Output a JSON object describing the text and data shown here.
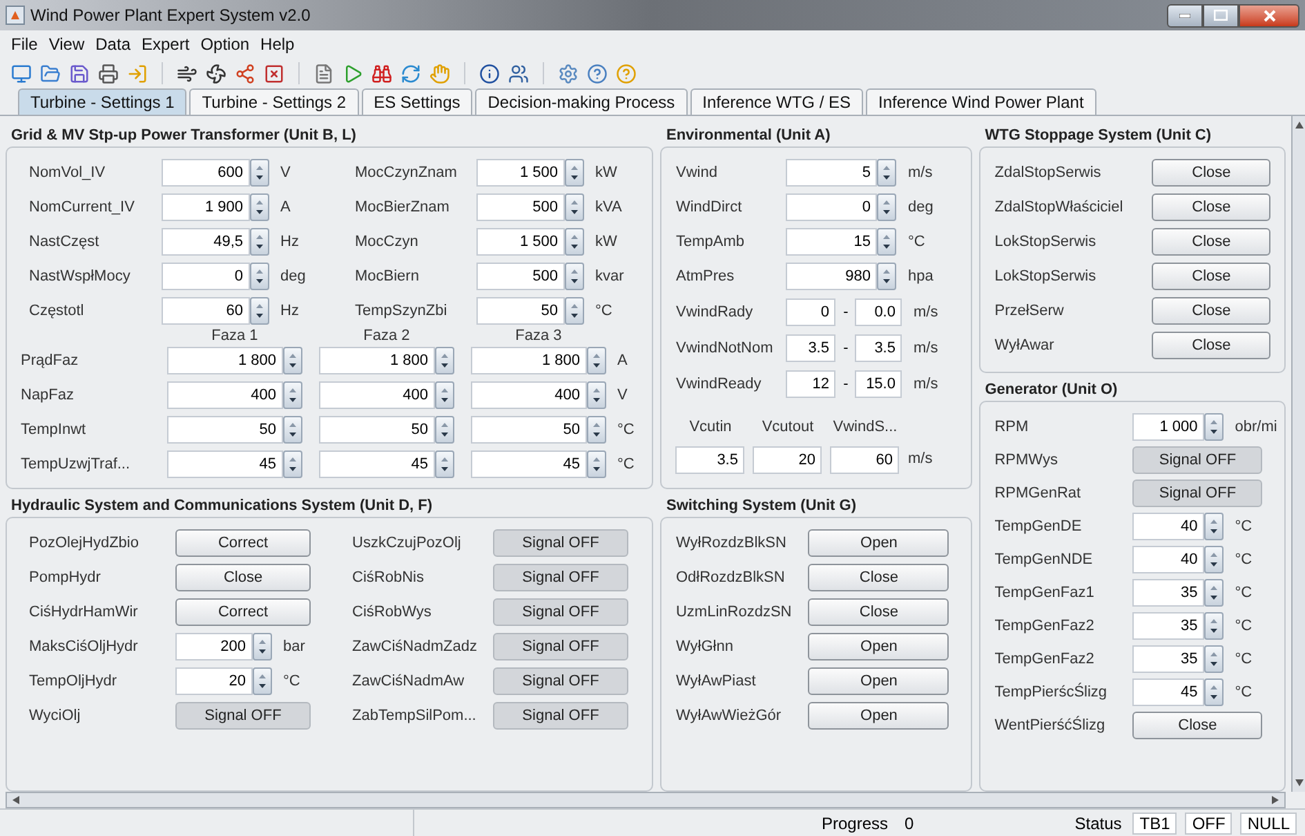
{
  "window": {
    "title": "Wind Power Plant Expert System  v2.0"
  },
  "menu": [
    "File",
    "View",
    "Data",
    "Expert",
    "Option",
    "Help"
  ],
  "tabs": [
    {
      "label": "Turbine - Settings 1",
      "selected": true
    },
    {
      "label": "Turbine - Settings 2",
      "selected": false
    },
    {
      "label": "ES Settings",
      "selected": false
    },
    {
      "label": "Decision-making Process",
      "selected": false
    },
    {
      "label": "Inference WTG / ES",
      "selected": false
    },
    {
      "label": "Inference Wind Power Plant",
      "selected": false
    }
  ],
  "grid_transformer": {
    "title": "Grid & MV Stp-up Power Transformer (Unit B, L)",
    "left_fields": [
      {
        "label": "NomVol_IV",
        "value": "600",
        "unit": "V"
      },
      {
        "label": "NomCurrent_IV",
        "value": "1 900",
        "unit": "A"
      },
      {
        "label": "NastCzęst",
        "value": "49,5",
        "unit": "Hz"
      },
      {
        "label": "NastWspłMocy",
        "value": "0",
        "unit": "deg"
      },
      {
        "label": "Częstotl",
        "value": "60",
        "unit": "Hz"
      }
    ],
    "right_fields": [
      {
        "label": "MocCzynZnam",
        "value": "1 500",
        "unit": "kW"
      },
      {
        "label": "MocBierZnam",
        "value": "500",
        "unit": "kVA"
      },
      {
        "label": "MocCzyn",
        "value": "1 500",
        "unit": "kW"
      },
      {
        "label": "MocBiern",
        "value": "500",
        "unit": "kvar"
      },
      {
        "label": "TempSzynZbi",
        "value": "50",
        "unit": "°C"
      }
    ],
    "phase_headers": [
      "Faza 1",
      "Faza 2",
      "Faza 3"
    ],
    "phase_rows": [
      {
        "label": "PrądFaz",
        "values": [
          "1 800",
          "1 800",
          "1 800"
        ],
        "unit": "A"
      },
      {
        "label": "NapFaz",
        "values": [
          "400",
          "400",
          "400"
        ],
        "unit": "V"
      },
      {
        "label": "TempInwt",
        "values": [
          "50",
          "50",
          "50"
        ],
        "unit": "°C"
      },
      {
        "label": "TempUzwjTraf...",
        "values": [
          "45",
          "45",
          "45"
        ],
        "unit": "°C"
      }
    ]
  },
  "hydraulic": {
    "title": "Hydraulic System and Communications System (Unit D, F)",
    "left_rows": [
      {
        "kind": "button",
        "label": "PozOlejHydZbio",
        "value": "Correct"
      },
      {
        "kind": "button",
        "label": "PompHydr",
        "value": "Close"
      },
      {
        "kind": "button",
        "label": "CiśHydrHamWir",
        "value": "Correct"
      },
      {
        "kind": "spinner",
        "label": "MaksCiśOljHydr",
        "value": "200",
        "unit": "bar"
      },
      {
        "kind": "spinner",
        "label": "TempOljHydr",
        "value": "20",
        "unit": "°C"
      },
      {
        "kind": "signal",
        "label": "WyciOlj",
        "value": "Signal OFF"
      }
    ],
    "right_rows": [
      {
        "kind": "signal",
        "label": "UszkCzujPozOlj",
        "value": "Signal OFF"
      },
      {
        "kind": "signal",
        "label": "CiśRobNis",
        "value": "Signal OFF"
      },
      {
        "kind": "signal",
        "label": "CiśRobWys",
        "value": "Signal OFF"
      },
      {
        "kind": "signal",
        "label": "ZawCiśNadmZadz",
        "value": "Signal OFF"
      },
      {
        "kind": "signal",
        "label": "ZawCiśNadmAw",
        "value": "Signal OFF"
      },
      {
        "kind": "signal",
        "label": "ZabTempSilPom...",
        "value": "Signal OFF"
      }
    ]
  },
  "environmental": {
    "title": "Environmental (Unit A)",
    "spinners": [
      {
        "label": "Vwind",
        "value": "5",
        "unit": "m/s"
      },
      {
        "label": "WindDirct",
        "value": "0",
        "unit": "deg"
      },
      {
        "label": "TempAmb",
        "value": "15",
        "unit": "°C"
      },
      {
        "label": "AtmPres",
        "value": "980",
        "unit": "hpa"
      }
    ],
    "ranges": [
      {
        "label": "VwindRady",
        "from": "0",
        "to": "0.0",
        "unit": "m/s"
      },
      {
        "label": "VwindNotNom",
        "from": "3.5",
        "to": "3.5",
        "unit": "m/s"
      },
      {
        "label": "VwindReady",
        "from": "12",
        "to": "15.0",
        "unit": "m/s"
      }
    ],
    "range_separator": "-",
    "bottom_labels": [
      "Vcutin",
      "Vcutout",
      "VwindS..."
    ],
    "bottom_values": [
      "3.5",
      "20",
      "60"
    ],
    "bottom_unit": "m/s"
  },
  "switching": {
    "title": "Switching System (Unit G)",
    "rows": [
      {
        "kind": "button",
        "label": "WyłRozdzBlkSN",
        "value": "Open"
      },
      {
        "kind": "button",
        "label": "OdłRozdzBlkSN",
        "value": "Close"
      },
      {
        "kind": "button",
        "label": "UzmLinRozdzSN",
        "value": "Close"
      },
      {
        "kind": "button",
        "label": "WyłGłnn",
        "value": "Open"
      },
      {
        "kind": "button",
        "label": "WyłAwPiast",
        "value": "Open"
      },
      {
        "kind": "button",
        "label": "WyłAwWieżGór",
        "value": "Open"
      }
    ]
  },
  "wtg_stoppage": {
    "title": "WTG Stoppage System (Unit C)",
    "rows": [
      {
        "kind": "button",
        "label": "ZdalStopSerwis",
        "value": "Close"
      },
      {
        "kind": "button",
        "label": "ZdalStopWłaściciel",
        "value": "Close"
      },
      {
        "kind": "button",
        "label": "LokStopSerwis",
        "value": "Close"
      },
      {
        "kind": "button",
        "label": "LokStopSerwis",
        "value": "Close"
      },
      {
        "kind": "button",
        "label": "PrzełSerw",
        "value": "Close"
      },
      {
        "kind": "button",
        "label": "WyłAwar",
        "value": "Close"
      }
    ]
  },
  "generator": {
    "title": "Generator (Unit O)",
    "rows": [
      {
        "kind": "spinner",
        "label": "RPM",
        "value": "1 000",
        "unit": "obr/mi"
      },
      {
        "kind": "signal",
        "label": "RPMWys",
        "value": "Signal OFF"
      },
      {
        "kind": "signal",
        "label": "RPMGenRat",
        "value": "Signal OFF"
      },
      {
        "kind": "spinner",
        "label": "TempGenDE",
        "value": "40",
        "unit": "°C"
      },
      {
        "kind": "spinner",
        "label": "TempGenNDE",
        "value": "40",
        "unit": "°C"
      },
      {
        "kind": "spinner",
        "label": "TempGenFaz1",
        "value": "35",
        "unit": "°C"
      },
      {
        "kind": "spinner",
        "label": "TempGenFaz2",
        "value": "35",
        "unit": "°C"
      },
      {
        "kind": "spinner",
        "label": "TempGenFaz2",
        "value": "35",
        "unit": "°C"
      },
      {
        "kind": "spinner",
        "label": "TempPierścŚlizg",
        "value": "45",
        "unit": "°C"
      },
      {
        "kind": "button",
        "label": "WentPierśćŚlizg",
        "value": "Close"
      }
    ]
  },
  "status_bar": {
    "progress_label": "Progress",
    "progress_value": "0",
    "status_label": "Status",
    "status_fields": [
      "TB1",
      "OFF",
      "NULL"
    ]
  }
}
